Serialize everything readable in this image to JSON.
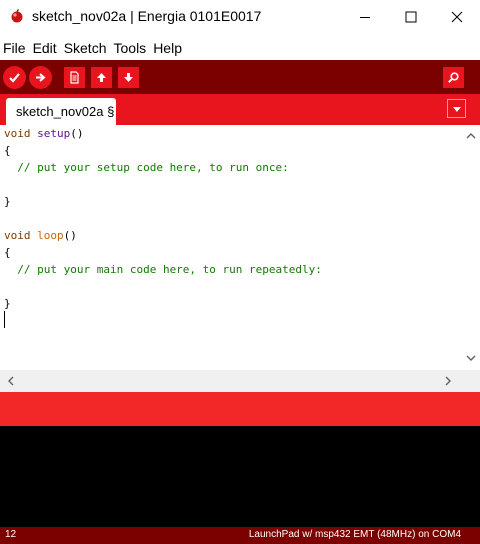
{
  "window": {
    "title": "sketch_nov02a | Energia 0101E0017",
    "minimize_icon": "minimize-icon",
    "maximize_icon": "maximize-icon",
    "close_icon": "close-icon"
  },
  "menu": {
    "items": [
      "File",
      "Edit",
      "Sketch",
      "Tools",
      "Help"
    ]
  },
  "toolbar": {
    "buttons": [
      "verify-icon",
      "upload-icon",
      "new-icon",
      "open-icon",
      "save-icon"
    ],
    "serial_monitor_icon": "serial-monitor-icon"
  },
  "tabs": {
    "active_label": "sketch_nov02a §",
    "menu_icon": "tab-menu-icon"
  },
  "editor": {
    "void_kw": "void",
    "setup_fn": "setup",
    "loop_fn": "loop",
    "parens": "()",
    "open_brace": "{",
    "close_brace": "}",
    "setup_comment": "  // put your setup code here, to run once:",
    "loop_comment": "  // put your main code here, to run repeatedly:"
  },
  "status": {
    "line_number": "12",
    "board": "LaunchPad w/ msp432 EMT (48MHz) on COM4"
  },
  "colors": {
    "toolbar_bg": "#7b0000",
    "accent_red": "#e8141e",
    "message_red": "#f22727",
    "console_bg": "#000000"
  }
}
